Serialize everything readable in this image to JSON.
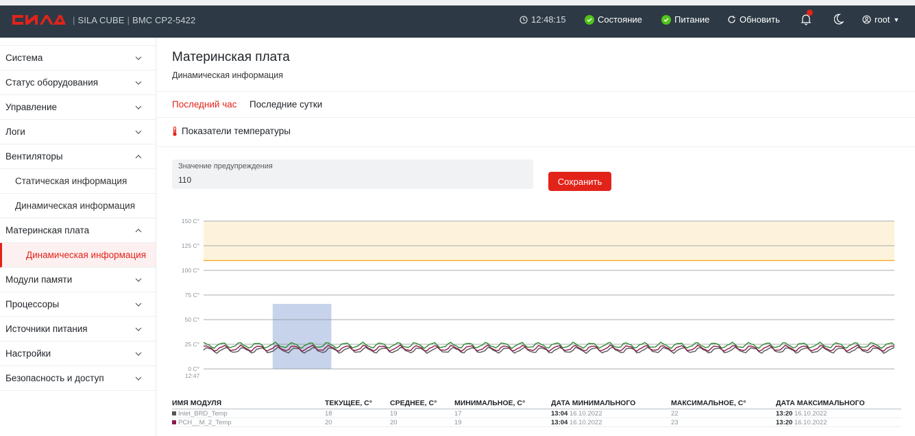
{
  "header": {
    "brand_logo_text": "СИЛА",
    "product": "SILA CUBE",
    "device": "BMC CP2-5422",
    "time": "12:48:15",
    "status_label": "Состояние",
    "power_label": "Питание",
    "refresh_label": "Обновить",
    "user": "root",
    "colors": {
      "bar": "#2d3a45",
      "accent": "#e2231a",
      "ok": "#52c41a"
    }
  },
  "sidebar": {
    "items": [
      {
        "label": "Система"
      },
      {
        "label": "Статус оборудования"
      },
      {
        "label": "Управление"
      },
      {
        "label": "Логи"
      },
      {
        "label": "Вентиляторы",
        "sub": [
          "Статическая информация",
          "Динамическая информация"
        ]
      },
      {
        "label": "Материнская плата",
        "sub": [
          "Динамическая информация"
        ]
      },
      {
        "label": "Модули памяти"
      },
      {
        "label": "Процессоры"
      },
      {
        "label": "Источники питания"
      },
      {
        "label": "Настройки"
      },
      {
        "label": "Безопасность и доступ"
      }
    ]
  },
  "main": {
    "title": "Материнская плата",
    "subtitle": "Динамическая информация",
    "tabs": [
      "Последний час",
      "Последние сутки"
    ],
    "section_title": "Показатели температуры",
    "warning_label": "Значение предупреждения",
    "warning_value": "110",
    "save_label": "Сохранить"
  },
  "chart_data": {
    "type": "line",
    "y_ticks": [
      "0 C°",
      "25 C°",
      "50 C°",
      "75 C°",
      "100 C°",
      "125 C°",
      "150 C°"
    ],
    "ylim": [
      0,
      150
    ],
    "x_start_label": "12:47",
    "warning_level": 110,
    "warning_band": [
      110,
      150
    ],
    "highlight_range": [
      0.1,
      0.185
    ],
    "grid": true,
    "series": [
      {
        "name": "Inlet_BRD_Temp",
        "color": "#555555",
        "base": 19,
        "amp": 2.5
      },
      {
        "name": "PCH__M_2_Temp",
        "color": "#8a1a4b",
        "base": 21,
        "amp": 2.5
      },
      {
        "color": "#2f8a2f",
        "base": 24,
        "amp": 2.5
      }
    ]
  },
  "table": {
    "headers": [
      "ИМЯ МОДУЛЯ",
      "ТЕКУЩЕЕ, C°",
      "СРЕДНЕЕ, C°",
      "МИНИМАЛЬНОЕ, C°",
      "ДАТА МИНИМАЛЬНОГО",
      "МАКСИМАЛЬНОЕ, C°",
      "ДАТА МАКСИМАЛЬНОГО"
    ],
    "rows": [
      {
        "name": "Inlet_BRD_Temp",
        "color": "#555555",
        "current": "18",
        "avg": "19",
        "min": "17",
        "min_time": "13:04",
        "min_date": "16.10.2022",
        "max": "22",
        "max_time": "13:20",
        "max_date": "16.10.2022"
      },
      {
        "name": "PCH__M_2_Temp",
        "color": "#8a1a4b",
        "current": "20",
        "avg": "20",
        "min": "19",
        "min_time": "13:04",
        "min_date": "16.10.2022",
        "max": "23",
        "max_time": "13:20",
        "max_date": "16.10.2022"
      }
    ]
  }
}
